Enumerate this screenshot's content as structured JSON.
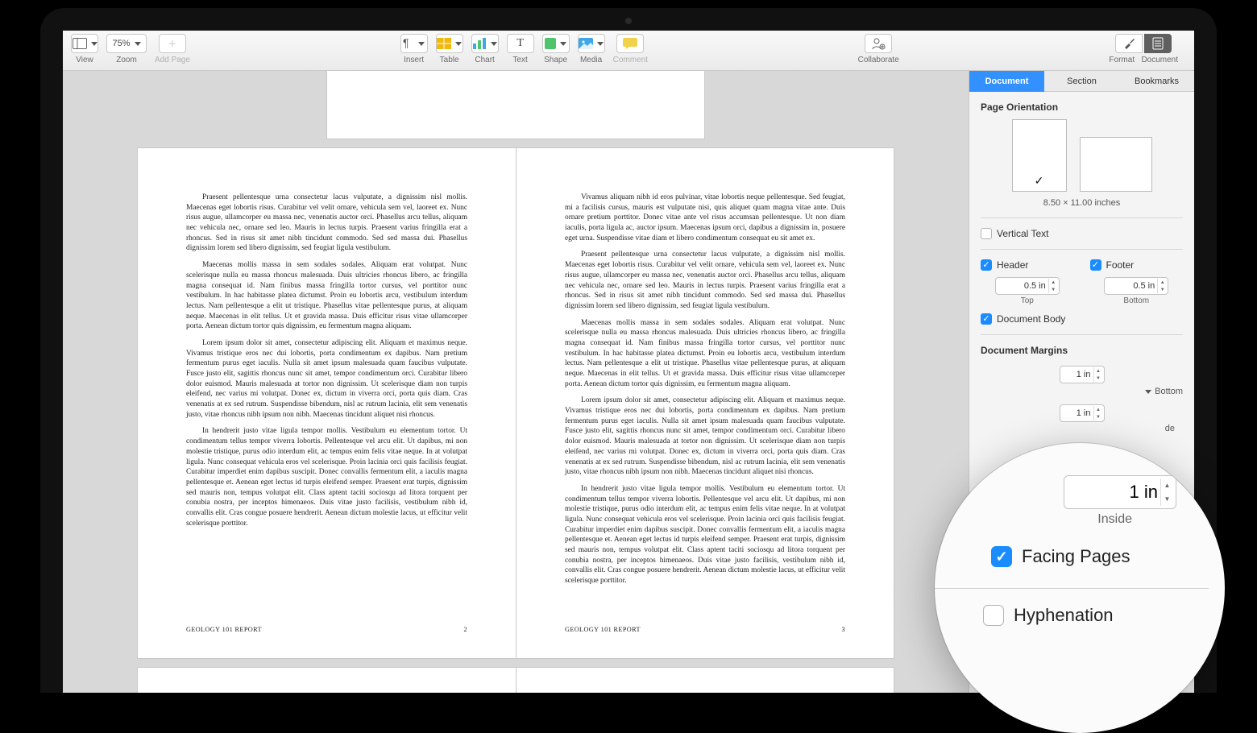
{
  "toolbar": {
    "view": "View",
    "zoom_value": "75%",
    "zoom_label": "Zoom",
    "add_page": "Add Page",
    "insert": "Insert",
    "table": "Table",
    "chart": "Chart",
    "text": "Text",
    "shape": "Shape",
    "media": "Media",
    "comment": "Comment",
    "collaborate": "Collaborate",
    "format": "Format",
    "document": "Document"
  },
  "tabs": {
    "document": "Document",
    "section": "Section",
    "bookmarks": "Bookmarks"
  },
  "sidebar": {
    "orientation_title": "Page Orientation",
    "page_size": "8.50 × 11.00 inches",
    "vertical_text": "Vertical Text",
    "header": "Header",
    "footer": "Footer",
    "header_val": "0.5 in",
    "footer_val": "0.5 in",
    "top": "Top",
    "bottom": "Bottom",
    "document_body": "Document Body",
    "margins_title": "Document Margins",
    "margin_val": "1 in",
    "bottom_label": "Bottom",
    "de_suffix": "de"
  },
  "magnifier": {
    "inside_val": "1 in",
    "inside_label": "Inside",
    "facing_pages": "Facing Pages",
    "hyphenation": "Hyphenation"
  },
  "document": {
    "footer_title": "GEOLOGY 101 REPORT",
    "page_left_num": "2",
    "page_right_num": "3",
    "paragraphs": [
      "Praesent pellentesque urna consectetur lacus vulputate, a dignissim nisl mollis. Maecenas eget lobortis risus. Curabitur vel velit ornare, vehicula sem vel, laoreet ex. Nunc risus augue, ullamcorper eu massa nec, venenatis auctor orci. Phasellus arcu tellus, aliquam nec vehicula nec, ornare sed leo. Mauris in lectus turpis. Praesent varius fringilla erat a rhoncus. Sed in risus sit amet nibh tincidunt commodo. Sed sed massa dui. Phasellus dignissim lorem sed libero dignissim, sed feugiat ligula vestibulum.",
      "Maecenas mollis massa in sem sodales sodales. Aliquam erat volutpat. Nunc scelerisque nulla eu massa rhoncus malesuada. Duis ultricies rhoncus libero, ac fringilla magna consequat id. Nam finibus massa fringilla tortor cursus, vel porttitor nunc vestibulum. In hac habitasse platea dictumst. Proin eu lobortis arcu, vestibulum interdum lectus. Nam pellentesque a elit ut tristique. Phasellus vitae pellentesque purus, at aliquam neque. Maecenas in elit tellus. Ut et gravida massa. Duis efficitur risus vitae ullamcorper porta. Aenean dictum tortor quis dignissim, eu fermentum magna aliquam.",
      "Lorem ipsum dolor sit amet, consectetur adipiscing elit. Aliquam et maximus neque. Vivamus tristique eros nec dui lobortis, porta condimentum ex dapibus. Nam pretium fermentum purus eget iaculis. Nulla sit amet ipsum malesuada quam faucibus vulputate. Fusce justo elit, sagittis rhoncus nunc sit amet, tempor condimentum orci. Curabitur libero dolor euismod. Mauris malesuada at tortor non dignissim. Ut scelerisque diam non turpis eleifend, nec varius mi volutpat. Donec ex, dictum in viverra orci, porta quis diam. Cras venenatis at ex sed rutrum. Suspendisse bibendum, nisl ac rutrum lacinia, elit sem venenatis justo, vitae rhoncus nibh ipsum non nibh. Maecenas tincidunt aliquet nisi rhoncus.",
      "In hendrerit justo vitae ligula tempor mollis. Vestibulum eu elementum tortor. Ut condimentum tellus tempor viverra lobortis. Pellentesque vel arcu elit. Ut dapibus, mi non molestie tristique, purus odio interdum elit, ac tempus enim felis vitae neque. In at volutpat ligula. Nunc consequat vehicula eros vel scelerisque. Proin lacinia orci quis facilisis feugiat. Curabitur imperdiet enim dapibus suscipit. Donec convallis fermentum elit, a iaculis magna pellentesque et. Aenean eget lectus id turpis eleifend semper. Praesent erat turpis, dignissim sed mauris non, tempus volutpat elit. Class aptent taciti sociosqu ad litora torquent per conubia nostra, per inceptos himenaeos. Duis vitae justo facilisis, vestibulum nibh id, convallis elit. Cras congue posuere hendrerit. Aenean dictum molestie lacus, ut efficitur velit scelerisque porttitor.",
      "Vivamus aliquam nibh id eros pulvinar, vitae lobortis neque pellentesque. Sed feugiat, mi a facilisis cursus, mauris est vulputate nisi, quis aliquet quam magna vitae ante. Duis ornare pretium porttitor. Donec vitae ante vel risus accumsan pellentesque. Ut non diam iaculis, porta ligula ac, auctor ipsum. Maecenas ipsum orci, dapibus a dignissim in, posuere eget urna. Suspendisse vitae diam et libero condimentum consequat eu sit amet ex."
    ]
  }
}
